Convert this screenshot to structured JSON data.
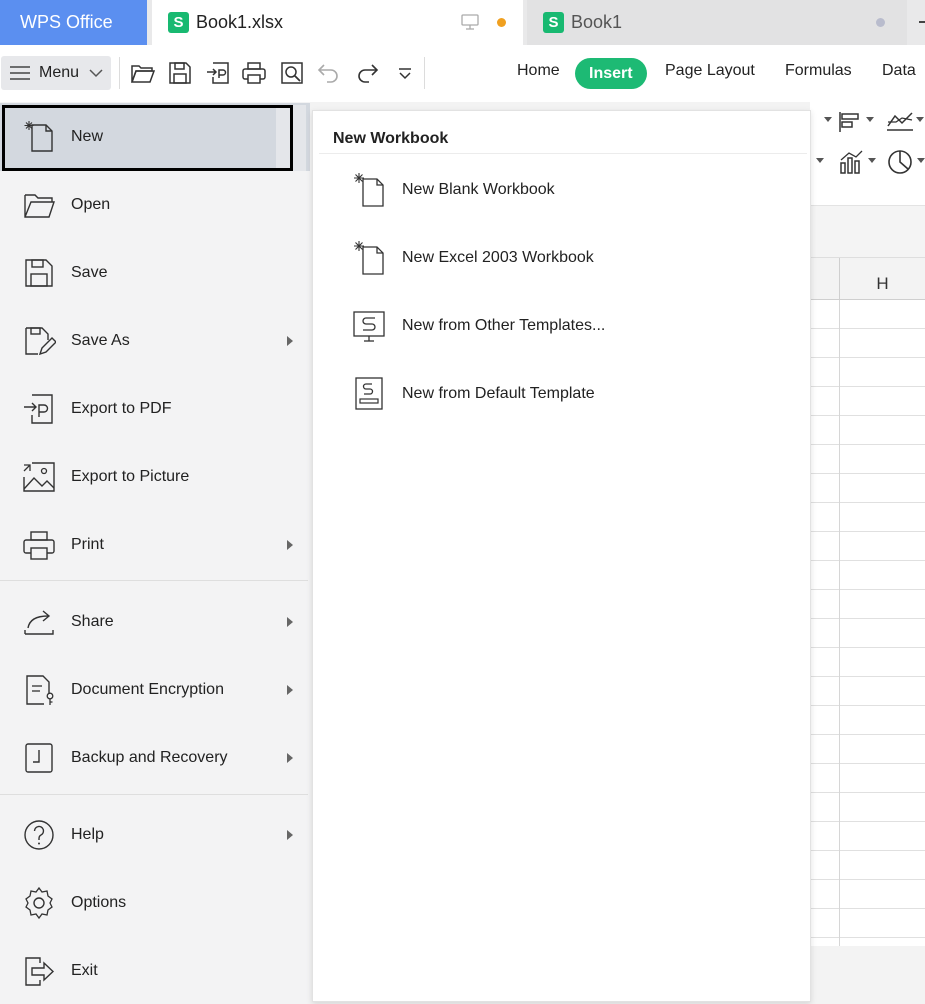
{
  "tabs": {
    "app": "WPS Office",
    "active_doc": "Book1.xlsx",
    "inactive_doc": "Book1",
    "doc_icon_letter": "S"
  },
  "toolbar": {
    "menu_label": "Menu",
    "ribbon_tabs": [
      "Home",
      "Insert",
      "Page Layout",
      "Formulas",
      "Data"
    ],
    "active_tab": "Insert"
  },
  "sheet": {
    "column_header": "H"
  },
  "file_menu": {
    "items": [
      {
        "label": "New",
        "icon": "new-file-icon",
        "has_submenu": false,
        "selected": true
      },
      {
        "label": "Open",
        "icon": "folder-open-icon",
        "has_submenu": false
      },
      {
        "label": "Save",
        "icon": "save-icon",
        "has_submenu": false
      },
      {
        "label": "Save As",
        "icon": "save-as-icon",
        "has_submenu": true
      },
      {
        "label": "Export to PDF",
        "icon": "export-pdf-icon",
        "has_submenu": false
      },
      {
        "label": "Export to Picture",
        "icon": "export-picture-icon",
        "has_submenu": false
      },
      {
        "label": "Print",
        "icon": "print-icon",
        "has_submenu": true
      },
      {
        "label": "Share",
        "icon": "share-icon",
        "has_submenu": true
      },
      {
        "label": "Document Encryption",
        "icon": "encryption-icon",
        "has_submenu": true
      },
      {
        "label": "Backup and Recovery",
        "icon": "backup-icon",
        "has_submenu": true
      },
      {
        "label": "Help",
        "icon": "help-icon",
        "has_submenu": true
      },
      {
        "label": "Options",
        "icon": "gear-icon",
        "has_submenu": false
      },
      {
        "label": "Exit",
        "icon": "exit-icon",
        "has_submenu": false
      }
    ]
  },
  "new_panel": {
    "title": "New Workbook",
    "items": [
      {
        "label": "New Blank Workbook",
        "icon": "new-blank-workbook-icon"
      },
      {
        "label": "New Excel 2003 Workbook",
        "icon": "new-excel-2003-icon"
      },
      {
        "label": "New from Other Templates...",
        "icon": "template-monitor-icon"
      },
      {
        "label": "New from Default Template",
        "icon": "default-template-icon"
      }
    ]
  },
  "colors": {
    "wps_tab": "#5b8ff0",
    "active_ribbon_tab": "#1dba74",
    "doc_icon": "#18b971",
    "unsaved_dot": "#f0a020",
    "selected_row": "#d3d8df"
  }
}
